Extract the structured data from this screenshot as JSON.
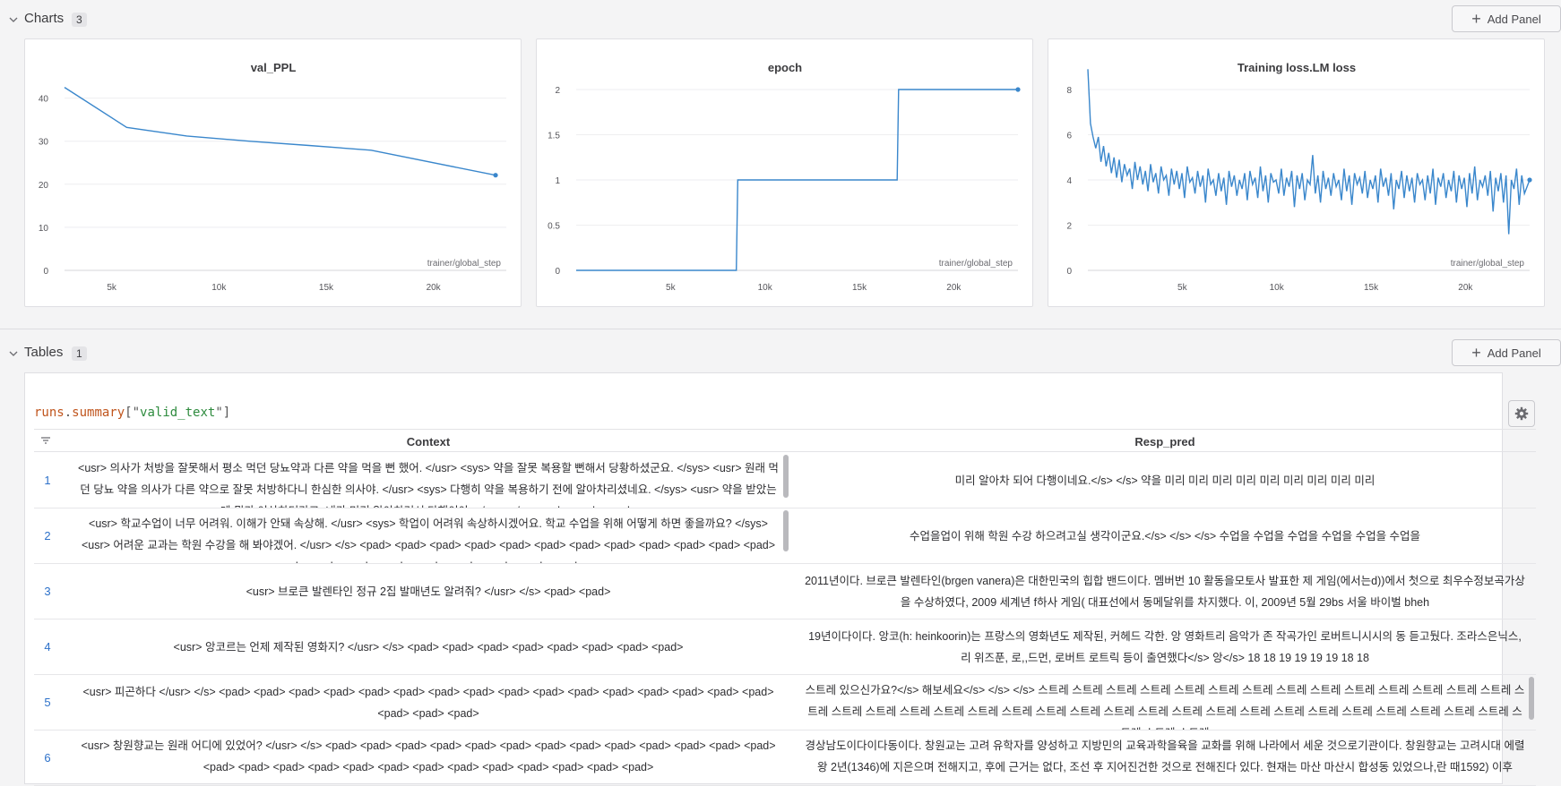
{
  "sections": {
    "charts": {
      "title": "Charts",
      "count": "3",
      "add_label": "Add Panel"
    },
    "tables": {
      "title": "Tables",
      "count": "1",
      "add_label": "Add Panel"
    }
  },
  "colors": {
    "line": "#3a87cc",
    "accent_link": "#2d71c9"
  },
  "chart_data": [
    {
      "type": "line",
      "title": "val_PPL",
      "xlabel": "trainer/global_step",
      "xlim": [
        2800,
        23400
      ],
      "ylim": [
        0,
        42
      ],
      "x_ticks": [
        "5k",
        "10k",
        "15k",
        "20k"
      ],
      "x_tick_values": [
        5000,
        10000,
        15000,
        20000
      ],
      "y_ticks": [
        "0",
        "10",
        "20",
        "30",
        "40"
      ],
      "y_tick_values": [
        0,
        10,
        20,
        30,
        40
      ],
      "series": [
        {
          "x": [
            2800,
            5700,
            8500,
            11400,
            14200,
            17100,
            22900
          ],
          "y": [
            42.5,
            33.2,
            31.2,
            30.0,
            29.0,
            27.9,
            22.1
          ]
        }
      ]
    },
    {
      "type": "line",
      "title": "epoch",
      "xlabel": "trainer/global_step",
      "xlim": [
        0,
        23400
      ],
      "ylim": [
        0,
        2
      ],
      "x_ticks": [
        "5k",
        "10k",
        "15k",
        "20k"
      ],
      "x_tick_values": [
        5000,
        10000,
        15000,
        20000
      ],
      "y_ticks": [
        "0",
        "0.5",
        "1",
        "1.5",
        "2"
      ],
      "y_tick_values": [
        0,
        0.5,
        1,
        1.5,
        2
      ],
      "series": [
        {
          "x": [
            0,
            8480,
            8560,
            17000,
            17080,
            23400
          ],
          "y": [
            0,
            0,
            1,
            1,
            2,
            2
          ]
        }
      ]
    },
    {
      "type": "line",
      "title": "Training loss.LM loss",
      "xlabel": "trainer/global_step",
      "xlim": [
        0,
        23400
      ],
      "ylim": [
        0,
        8
      ],
      "x_ticks": [
        "5k",
        "10k",
        "15k",
        "20k"
      ],
      "x_tick_values": [
        5000,
        10000,
        15000,
        20000
      ],
      "y_ticks": [
        "0",
        "2",
        "4",
        "6",
        "8"
      ],
      "y_tick_values": [
        0,
        2,
        4,
        6,
        8
      ],
      "series": [
        {
          "x_start": 0,
          "x_end": 23400,
          "y": [
            8.9,
            6.5,
            5.9,
            5.4,
            5.9,
            4.8,
            5.5,
            4.6,
            5.2,
            4.3,
            5.0,
            4.1,
            4.9,
            3.9,
            4.7,
            4.2,
            4.5,
            3.6,
            4.8,
            4.0,
            4.6,
            3.8,
            4.4,
            3.5,
            4.7,
            3.9,
            4.3,
            3.4,
            4.6,
            4.0,
            4.2,
            3.3,
            4.5,
            3.8,
            4.4,
            3.6,
            4.3,
            3.2,
            4.6,
            3.9,
            4.1,
            3.4,
            4.4,
            3.7,
            4.2,
            3.0,
            4.5,
            3.8,
            4.0,
            3.3,
            4.3,
            3.5,
            4.1,
            2.9,
            4.4,
            3.7,
            4.2,
            3.3,
            4.0,
            3.6,
            4.3,
            3.1,
            4.4,
            3.8,
            4.1,
            3.2,
            4.6,
            3.5,
            4.2,
            3.0,
            4.3,
            3.9,
            4.0,
            3.4,
            4.5,
            3.3,
            4.1,
            3.7,
            4.4,
            2.8,
            4.2,
            3.6,
            4.3,
            3.1,
            4.0,
            3.8,
            5.1,
            3.4,
            4.2,
            3.0,
            4.4,
            3.6,
            4.1,
            3.3,
            4.3,
            3.7,
            4.0,
            3.1,
            4.5,
            3.5,
            4.2,
            2.9,
            4.3,
            3.8,
            4.1,
            3.4,
            4.4,
            3.2,
            4.0,
            3.6,
            4.2,
            3.0,
            4.5,
            3.7,
            4.1,
            3.3,
            4.3,
            2.7,
            4.0,
            3.6,
            4.4,
            3.2,
            4.2,
            3.5,
            4.1,
            3.0,
            4.3,
            3.8,
            4.0,
            3.1,
            4.2,
            3.4,
            4.5,
            2.9,
            4.1,
            3.7,
            4.3,
            3.2,
            4.0,
            3.5,
            4.4,
            3.0,
            4.2,
            3.6,
            4.1,
            2.8,
            4.3,
            3.4,
            4.6,
            3.1,
            4.0,
            3.7,
            4.2,
            3.3,
            4.4,
            2.6,
            4.1,
            3.5,
            4.3,
            3.0,
            4.2,
            1.6,
            4.0,
            3.6,
            4.5,
            2.9,
            4.2,
            3.4,
            3.7,
            4.0
          ]
        }
      ]
    }
  ],
  "table": {
    "query_a": "runs",
    "query_b": ".",
    "query_c": "summary",
    "query_d": "[\"",
    "query_e": "valid_text",
    "query_f": "\"]",
    "columns": [
      "Context",
      "Resp_pred"
    ],
    "rows": [
      {
        "num": "1",
        "context": "<usr> 의사가 처방을 잘못해서 평소 먹던 당뇨약과 다른 약을 먹을 뻔 했어. </usr> <sys> 약을 잘못 복용할 뻔해서 당황하셨군요. </sys> <usr> 원래 먹던 당뇨 약을 의사가 다른 약으로 잘못 처방하다니 한심한 의사야. </usr> <sys> 다행히 약을 복용하기 전에 알아차리셨네요. </sys> <usr> 약을 받았는데 뭔가 이상하더라고. 내가 미리 알아차려서 다행이야. </usr> </s> <pad> <pad> <pad>",
        "resp": "미리 알아차 되어 다행이네요.</s> </s> 약을 미리 미리 미리 미리 미리 미리 미리 미리 미리"
      },
      {
        "num": "2",
        "context": "<usr> 학교수업이 너무 어려워. 이해가 안돼 속상해. </usr> <sys> 학업이 어려워 속상하시겠어요. 학교 수업을 위해 어떻게 하면 좋을까요? </sys> <usr> 어려운 교과는 학원 수강을 해 봐야겠어. </usr> </s> <pad> <pad> <pad> <pad> <pad> <pad> <pad> <pad> <pad> <pad> <pad> <pad> <pad> <pad> <pad> <pad> <pad> <pad> <pad> <pad> <pad>",
        "resp": "수업을업이 위해 학원 수강 하으려고실 생각이군요.</s> </s> </s> 수업을 수업을 수업을 수업을 수업을 수업을"
      },
      {
        "num": "3",
        "context": "<usr> 브로큰 발렌타인 정규 2집 발매년도 알려줘? </usr> </s> <pad> <pad>",
        "resp": "2011년이다. 브로큰 발렌타인(brgen vanera)은 대한민국의 힙합 밴드이다. 멤버번 10 활동을모토사 발표한 제 게임(에서는d))에서 첫으로 최우수정보곡가상을 수상하였다, 2009 세계년 f하사 게임( 대표선에서 동메달위를 차지했다. 이, 2009년 5월 29bs 서울 바이벌 bheh"
      },
      {
        "num": "4",
        "context": "<usr> 앙코르는 언제 제작된 영화지? </usr> </s> <pad> <pad> <pad> <pad> <pad> <pad> <pad> <pad>",
        "resp": "19년이다이다. 앙코(h: heinkoorin)는 프랑스의 영화년도 제작된, 커헤드 각한. 앙 영화트리 음악가 존 작곡가인 로버트니시시의 동 듣고뒀다. 조라스은닉스, 리 위즈푼, 로,,드먼, 로버트 로트릭 등이 출연했다</s> 앙</s> 18 18 19 19 19 19 18 18"
      },
      {
        "num": "5",
        "context": "<usr> 피곤하다 </usr> </s> <pad> <pad> <pad> <pad> <pad> <pad> <pad> <pad> <pad> <pad> <pad> <pad> <pad> <pad> <pad> <pad> <pad> <pad> <pad>",
        "resp": "스트레 있으신가요?</s> 해보세요</s> </s> </s> 스트레 스트레 스트레 스트레 스트레 스트레 스트레 스트레 스트레 스트레 스트레 스트레 스트레 스트레 스트레 스트레 스트레 스트레 스트레 스트레 스트레 스트레 스트레 스트레 스트레 스트레 스트레 스트레 스트레 스트레 스트레 스트레 스트레 스트레 스트레 스트레 스트레 스트레"
      },
      {
        "num": "6",
        "context": "<usr> 창원향교는 원래 어디에 있었어? </usr> </s> <pad> <pad> <pad> <pad> <pad> <pad> <pad> <pad> <pad> <pad> <pad> <pad> <pad> <pad> <pad> <pad> <pad> <pad> <pad> <pad> <pad> <pad> <pad> <pad> <pad> <pad>",
        "resp": "경상남도이다이다동이다. 창원교는 고려 유학자를 양성하고 지방민의 교육과학을육을 교화를 위해 나라에서 세운 것으로기관이다. 창원향교는 고려시대 에렬왕 2년(1346)에 지은으며 전해지고, 후에 근거는 없다, 조선 후 지어진건한 것으로 전해진다 있다. 현재는 마산 마산시 합성동 있었으나,란 때1592) 이후"
      }
    ]
  }
}
